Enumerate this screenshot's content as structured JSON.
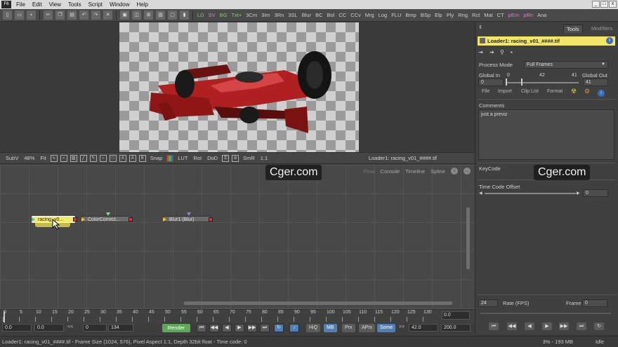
{
  "app": {
    "logo": "F6"
  },
  "menu": [
    "File",
    "Edit",
    "View",
    "Tools",
    "Script",
    "Window",
    "Help"
  ],
  "window_controls": [
    "_",
    "□",
    "x"
  ],
  "toolbar_tools": [
    {
      "label": "LD",
      "color": "green"
    },
    {
      "label": "SV",
      "color": "pink"
    },
    {
      "label": "BG",
      "color": "green"
    },
    {
      "label": "Txt+",
      "color": "green"
    },
    {
      "label": "3Cm",
      "color": ""
    },
    {
      "label": "3Im",
      "color": ""
    },
    {
      "label": "3Rn",
      "color": ""
    },
    {
      "label": "3SL",
      "color": ""
    },
    {
      "label": "Blur",
      "color": ""
    },
    {
      "label": "BC",
      "color": ""
    },
    {
      "label": "Bol",
      "color": ""
    },
    {
      "label": "CC",
      "color": ""
    },
    {
      "label": "CCv",
      "color": ""
    },
    {
      "label": "Mrg",
      "color": ""
    },
    {
      "label": "Log",
      "color": ""
    },
    {
      "label": "FLU",
      "color": ""
    },
    {
      "label": "Bmp",
      "color": ""
    },
    {
      "label": "BSp",
      "color": ""
    },
    {
      "label": "Elp",
      "color": ""
    },
    {
      "label": "Ply",
      "color": ""
    },
    {
      "label": "Rng",
      "color": ""
    },
    {
      "label": "Rct",
      "color": ""
    },
    {
      "label": "Mat",
      "color": ""
    },
    {
      "label": "CT",
      "color": ""
    },
    {
      "label": "pEm",
      "color": "pink"
    },
    {
      "label": "pRn",
      "color": "pink"
    },
    {
      "label": "Ana",
      "color": ""
    }
  ],
  "viewer_toolbar": {
    "subv": "SubV",
    "zoom": "48%",
    "fit": "Fit",
    "snap": "Snap",
    "lut": "LUT",
    "roi": "RoI",
    "dod": "DoD",
    "smr": "SmR",
    "ratio": "1:1",
    "title": "Loader1: racing_v01_####.tif"
  },
  "flow": {
    "tabs": [
      "Flow",
      "Console",
      "Timeline",
      "Spline"
    ],
    "nodes": [
      {
        "label": "racing_v0..."
      },
      {
        "label": "ColorCorrect..."
      },
      {
        "label": "Blur1 (Blur)"
      }
    ]
  },
  "timeline": {
    "ticks": [
      "0",
      "5",
      "10",
      "15",
      "20",
      "25",
      "30",
      "35",
      "40",
      "45",
      "50",
      "55",
      "60",
      "65",
      "70",
      "75",
      "80",
      "85",
      "90",
      "95",
      "100",
      "105",
      "110",
      "115",
      "120",
      "125",
      "130"
    ],
    "global_value": "0.0"
  },
  "transport": {
    "start": "0.0",
    "render_start": "0.0",
    "rewind": "<<",
    "current": "0",
    "end_frame": "134",
    "render_label": "Render",
    "hiq": "HiQ",
    "mb": "MB",
    "prx": "Prx",
    "aprx": "APrx",
    "some": "Some",
    "forward": ">>",
    "render_end": "42.0",
    "global_end": "200.0"
  },
  "status": {
    "text": "Loader1: racing_v01_####.tif - Frame Size (1024, 576), Pixel Aspect 1:1, Depth 32bit float - Time code: 0",
    "memory": "3% - 193 MB",
    "state": "Idle"
  },
  "panel": {
    "tabs": [
      "Tools",
      "Modifiers"
    ],
    "tool_title": "Loader1: racing_v01_####.tif",
    "process_mode_label": "Process Mode",
    "process_mode_value": "Full Frames",
    "global_in_label": "Global In",
    "global_in_value": "0",
    "global_out_label": "Global Out",
    "global_out_value": "41",
    "range_min": "0",
    "range_mid": "42",
    "range_max": "41",
    "subtabs": [
      "File",
      "Import",
      "Clip List",
      "Format"
    ],
    "comments_label": "Comments",
    "comments_text": "just a previz",
    "keycode_label": "KeyCode",
    "timecode_label": "Time Code Offset",
    "timecode_value": "0",
    "rate_value": "24",
    "rate_label": "Rate (FPS)",
    "frame_label": "Frame",
    "frame_value": "0"
  },
  "watermarks": [
    "Cger.com",
    "Cger.com"
  ]
}
